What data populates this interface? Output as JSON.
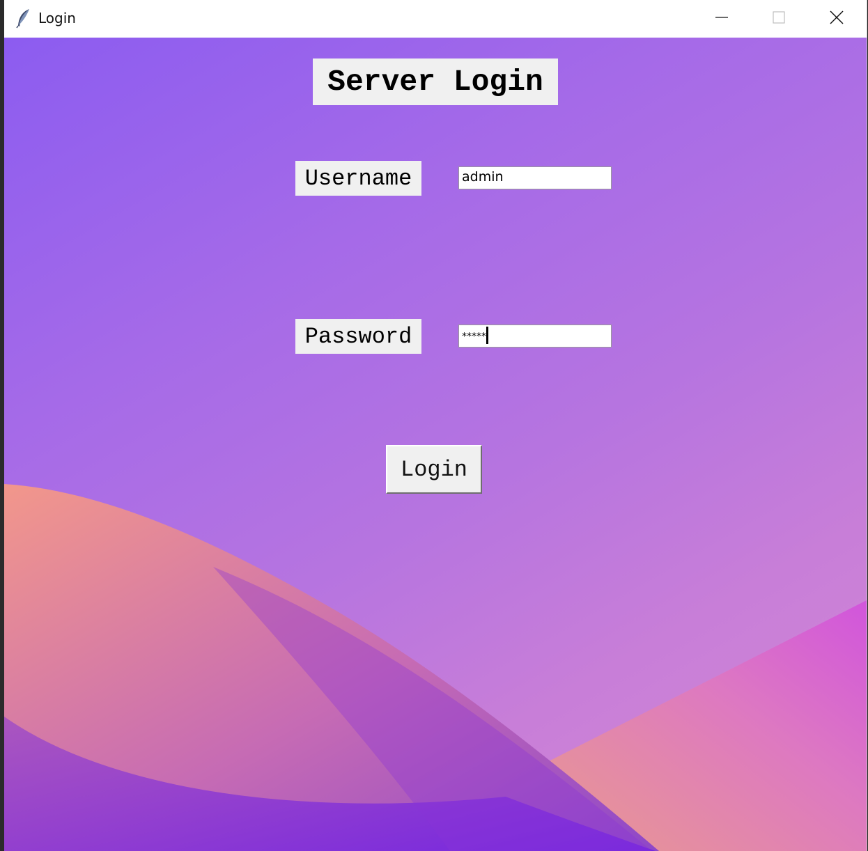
{
  "window": {
    "title": "Login",
    "controls": {
      "minimize": "minimize-icon",
      "maximize": "maximize-icon",
      "close": "close-icon"
    }
  },
  "form": {
    "heading": "Server Login",
    "username_label": "Username",
    "username_value": "admin",
    "password_label": "Password",
    "password_mask": "*****",
    "login_button": "Login"
  },
  "colors": {
    "background_top": "#8c5cf0",
    "background_bottom": "#d48ad4",
    "wave_coral": "#f2978b",
    "wave_violet": "#7a22e6",
    "widget_gray": "#f0f0f0"
  }
}
